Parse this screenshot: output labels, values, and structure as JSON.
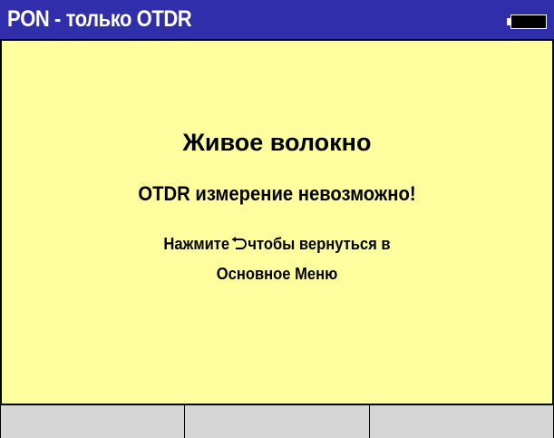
{
  "title_bar": {
    "title": "PON - только OTDR",
    "battery_icon": "battery-icon"
  },
  "message": {
    "heading": "Живое волокно",
    "subheading": "OTDR измерение невозможно!",
    "instruction_before_icon": "Нажмите",
    "instruction_icon": "back-arrow-icon",
    "instruction_after_icon": "чтобы вернуться в",
    "instruction_line2": "Основное Меню"
  },
  "softkeys": [
    {
      "label": ""
    },
    {
      "label": ""
    },
    {
      "label": ""
    }
  ],
  "colors": {
    "title_bar_bg": "#302eaa",
    "title_text": "#ffffff",
    "panel_bg": "#fffe9e",
    "softkey_bg": "#d6d6d6"
  }
}
